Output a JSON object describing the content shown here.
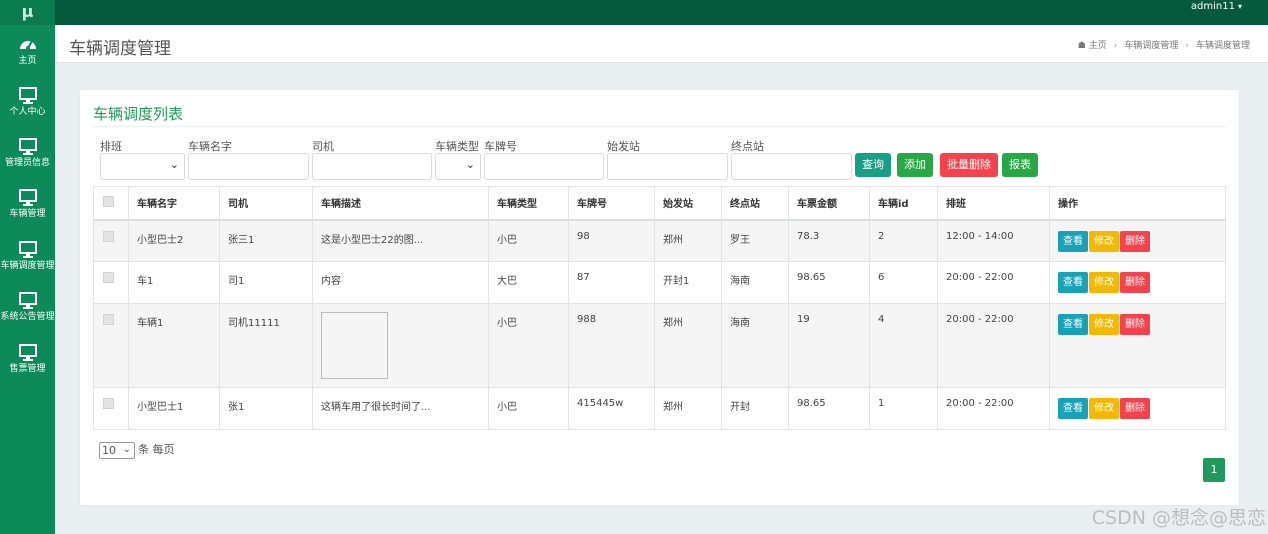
{
  "app": {
    "logo": "μ",
    "user": "admin11"
  },
  "sidebar": {
    "items": [
      {
        "label": "主页",
        "icon": "dashboard-icon"
      },
      {
        "label": "个人中心",
        "icon": "monitor-icon"
      },
      {
        "label": "管理员信息",
        "icon": "monitor-icon"
      },
      {
        "label": "车辆管理",
        "icon": "monitor-icon"
      },
      {
        "label": "车辆调度管理",
        "icon": "monitor-icon"
      },
      {
        "label": "系统公告管理",
        "icon": "monitor-icon"
      },
      {
        "label": "售票管理",
        "icon": "monitor-icon"
      }
    ]
  },
  "header": {
    "title": "车辆调度管理",
    "breadcrumb": [
      "主页",
      "车辆调度管理",
      "车辆调度管理"
    ]
  },
  "panel": {
    "title": "车辆调度列表"
  },
  "filters": {
    "banci": "排班",
    "name": "车辆名字",
    "driver": "司机",
    "type": "车辆类型",
    "plate": "车牌号",
    "start": "始发站",
    "end": "终点站"
  },
  "buttons": {
    "query": "查询",
    "add": "添加",
    "batch_delete": "批量删除",
    "report": "报表"
  },
  "table": {
    "columns": [
      "车辆名字",
      "司机",
      "车辆描述",
      "车辆类型",
      "车牌号",
      "始发站",
      "终点站",
      "车票金额",
      "车辆id",
      "排班",
      "操作"
    ],
    "rows": [
      {
        "name": "小型巴士2",
        "driver": "张三1",
        "desc": "这是小型巴士22的图...",
        "type": "小巴",
        "plate": "98",
        "start": "郑州",
        "end": "罗王",
        "price": "78.3",
        "id": "2",
        "time": "12:00 - 14:00"
      },
      {
        "name": "车1",
        "driver": "司1",
        "desc": "内容",
        "type": "大巴",
        "plate": "87",
        "start": "开封1",
        "end": "海南",
        "price": "98.65",
        "id": "6",
        "time": "20:00 - 22:00"
      },
      {
        "name": "车辆1",
        "driver": "司机11111",
        "desc": "",
        "type": "小巴",
        "plate": "988",
        "start": "郑州",
        "end": "海南",
        "price": "19",
        "id": "4",
        "time": "20:00 - 22:00"
      },
      {
        "name": "小型巴士1",
        "driver": "张1",
        "desc": "这辆车用了很长时间了...",
        "type": "小巴",
        "plate": "415445w",
        "start": "郑州",
        "end": "开封",
        "price": "98.65",
        "id": "1",
        "time": "20:00 - 22:00"
      }
    ],
    "actions": {
      "view": "查看",
      "edit": "修改",
      "delete": "删除"
    }
  },
  "pager": {
    "size": "10",
    "size_suffix": "条 每页",
    "current": "1"
  },
  "watermark": "CSDN @想念@思恋",
  "colors": {
    "topbar": "#055a3d",
    "sidebar": "#0d8a5a",
    "accent": "#1e9b5a",
    "query": "#17a085",
    "add": "#28a745",
    "danger": "#f5424d",
    "view": "#17a2b8",
    "edit": "#f5b800"
  }
}
